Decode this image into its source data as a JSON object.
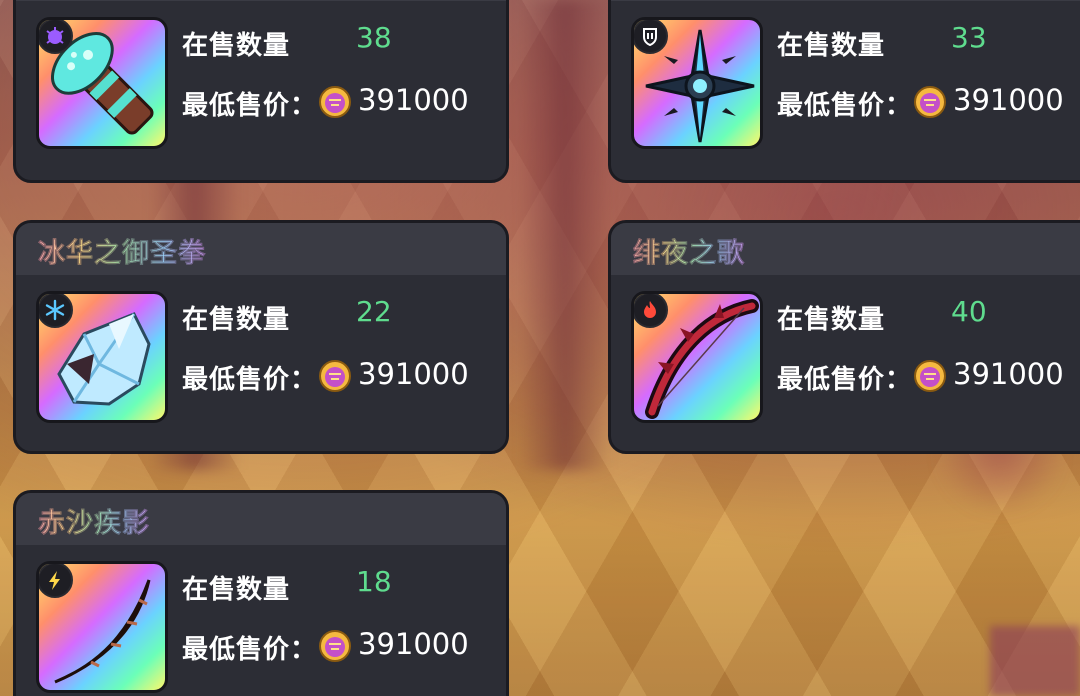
{
  "labels": {
    "qty": "在售数量",
    "price": "最低售价："
  },
  "items": [
    {
      "name": "",
      "qty": "38",
      "price": "391000",
      "badge": "bug-icon",
      "badge_color": "#9b5cff",
      "art": "mushroom-cannon-icon"
    },
    {
      "name": "",
      "qty": "33",
      "price": "391000",
      "badge": "shield-hand-icon",
      "badge_color": "#ffffff",
      "art": "spiked-star-icon"
    },
    {
      "name": "冰华之御圣拳",
      "qty": "22",
      "price": "391000",
      "badge": "snowflake-icon",
      "badge_color": "#5bc8ff",
      "art": "ice-fist-icon"
    },
    {
      "name": "绯夜之歌",
      "qty": "40",
      "price": "391000",
      "badge": "flame-icon",
      "badge_color": "#ff4a3a",
      "art": "crimson-bow-icon"
    },
    {
      "name": "赤沙疾影",
      "qty": "18",
      "price": "391000",
      "badge": "lightning-icon",
      "badge_color": "#ffd84a",
      "art": "sand-blade-icon"
    }
  ],
  "colors": {
    "quantity": "#5fdc8e",
    "card_bg": "#2c2d35",
    "title_bar": "#3a3b44"
  }
}
